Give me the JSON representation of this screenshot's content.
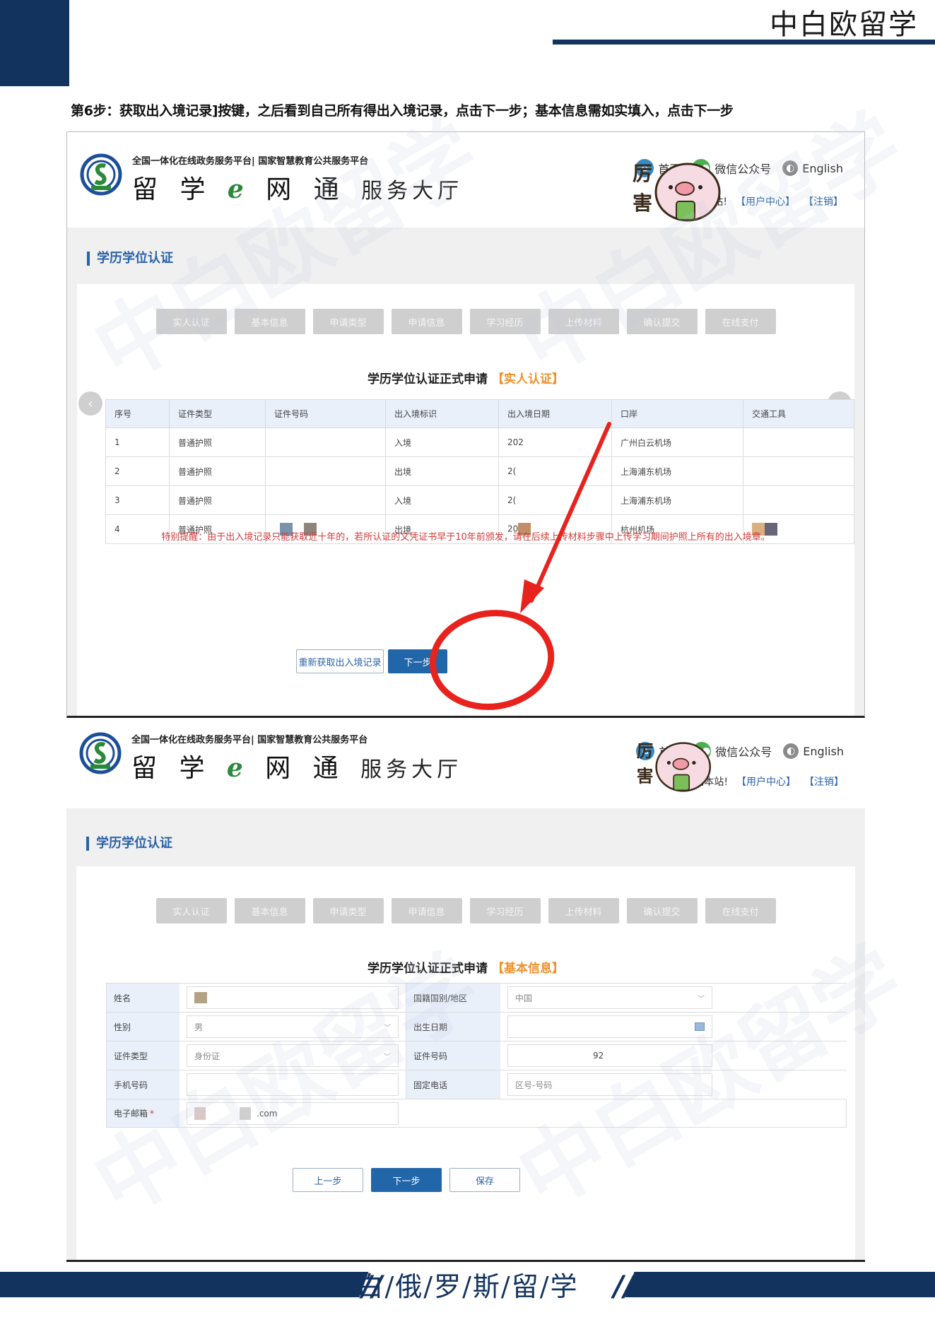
{
  "page": {
    "brand": "中白欧留学",
    "step_caption": "第6步：获取出入境记录]按键，之后看到自己所有得出入境记录，点击下一步；基本信息需如实填入，点击下一步",
    "footer": "白/俄/罗/斯/留/学",
    "footer_slashes": "//",
    "watermark": "中白欧留学"
  },
  "site": {
    "tagline": "全国一体化在线政务服务平台| 国家智慧教育公共服务平台",
    "name_part1": "留 学 ",
    "name_e": "e",
    "name_part2": " 网 通",
    "name_hall": "服务大厅",
    "nav": {
      "home": "首页",
      "wechat": "微信公众号",
      "english": "English"
    },
    "user": {
      "greeting_1": "站!",
      "greeting_2": "访问本站!",
      "center": "【用户中心】",
      "logout": "【注销】"
    },
    "sticker_text": "厉害"
  },
  "section_title": "学历学位认证",
  "steps": [
    "实人认证",
    "基本信息",
    "申请类型",
    "申请信息",
    "学习经历",
    "上传材料",
    "确认提交",
    "在线支付"
  ],
  "screen1": {
    "heading": "学历学位认证正式申请",
    "heading_tag": "【实人认证】",
    "table": {
      "headers": [
        "序号",
        "证件类型",
        "证件号码",
        "出入境标识",
        "出入境日期",
        "口岸",
        "交通工具"
      ],
      "rows": [
        [
          "1",
          "普通护照",
          "",
          "入境",
          "202",
          "广州白云机场",
          ""
        ],
        [
          "2",
          "普通护照",
          "",
          "出境",
          "2(",
          "上海浦东机场",
          ""
        ],
        [
          "3",
          "普通护照",
          "",
          "入境",
          "2(",
          "上海浦东机场",
          ""
        ],
        [
          "4",
          "普通护照",
          "",
          "出境",
          "20",
          "杭州机场",
          ""
        ]
      ]
    },
    "notice": "特别提醒：由于出入境记录只能获取近十年的，若所认证的文凭证书早于10年前颁发，请在后续上传材料步骤中上传学习期间护照上所有的出入境章。",
    "buttons": {
      "refetch": "重新获取出入境记录",
      "next": "下一步"
    },
    "prev_arrow": "‹",
    "next_arrow": "›"
  },
  "screen2": {
    "heading": "学历学位认证正式申请",
    "heading_tag": "【基本信息】",
    "form": {
      "name_label": "姓名",
      "name_value": "",
      "nationality_label": "国籍国别/地区",
      "nationality_value": "中国",
      "gender_label": "性别",
      "gender_value": "男",
      "birth_label": "出生日期",
      "birth_value": "",
      "id_type_label": "证件类型",
      "id_type_value": "身份证",
      "id_no_label": "证件号码",
      "id_no_value": "92",
      "mobile_label": "手机号码",
      "mobile_value": "",
      "landline_label": "固定电话",
      "landline_placeholder": "区号-号码",
      "email_label": "电子邮箱",
      "email_required": "*",
      "email_value": ".com"
    },
    "buttons": {
      "prev": "上一步",
      "next": "下一步",
      "save": "保存"
    }
  },
  "colors": {
    "navy": "#13335f",
    "primary_blue": "#2266aa",
    "accent_orange": "#f0902a",
    "notice_red": "#d23a3a",
    "annotation_red": "#e8221c"
  }
}
